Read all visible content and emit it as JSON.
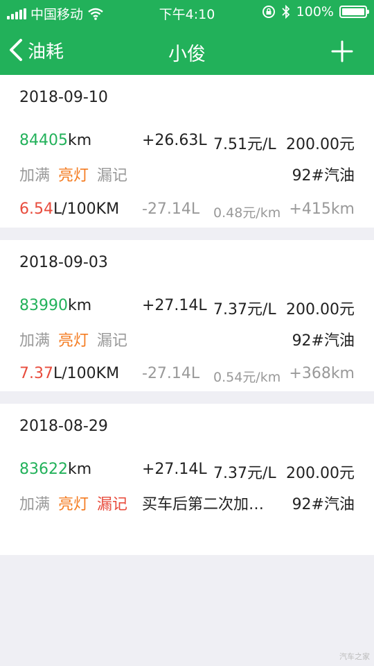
{
  "status_bar": {
    "carrier": "中国移动",
    "time": "下午4:10",
    "battery": "100%"
  },
  "nav": {
    "back_label": "油耗",
    "title": "小俊"
  },
  "records": [
    {
      "date": "2018-09-10",
      "odometer": "84405",
      "odometer_unit": "km",
      "fuel": "+26.63L",
      "unit_price": "7.51元/L",
      "total": "200.00元",
      "tags": [
        "加满",
        "亮灯",
        "漏记"
      ],
      "note": "",
      "grade": "92#汽油",
      "consumption": "6.54",
      "consumption_unit": "L/100KM",
      "fuel_diff": "-27.14L",
      "cost_per_km": "0.48元/km",
      "distance": "+415km"
    },
    {
      "date": "2018-09-03",
      "odometer": "83990",
      "odometer_unit": "km",
      "fuel": "+27.14L",
      "unit_price": "7.37元/L",
      "total": "200.00元",
      "tags": [
        "加满",
        "亮灯",
        "漏记"
      ],
      "note": "",
      "grade": "92#汽油",
      "consumption": "7.37",
      "consumption_unit": "L/100KM",
      "fuel_diff": "-27.14L",
      "cost_per_km": "0.54元/km",
      "distance": "+368km"
    },
    {
      "date": "2018-08-29",
      "odometer": "83622",
      "odometer_unit": "km",
      "fuel": "+27.14L",
      "unit_price": "7.37元/L",
      "total": "200.00元",
      "tags": [
        "加满",
        "亮灯",
        "漏记"
      ],
      "note": "买车后第二次加…",
      "grade": "92#汽油"
    }
  ],
  "watermark": "汽车之家"
}
